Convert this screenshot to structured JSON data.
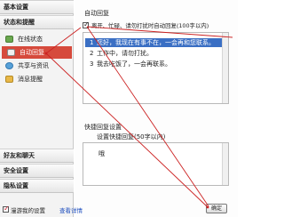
{
  "sidebar": {
    "categories": [
      {
        "label": "基本设置"
      },
      {
        "label": "状态和提醒"
      },
      {
        "label": "好友和聊天"
      },
      {
        "label": "安全设置"
      },
      {
        "label": "隐私设置"
      }
    ],
    "items": [
      {
        "label": "在线状态",
        "icon": "status-icon"
      },
      {
        "label": "自动回复",
        "icon": "auto-reply-icon"
      },
      {
        "label": "共享与资讯",
        "icon": "share-icon"
      },
      {
        "label": "消息提醒",
        "icon": "message-icon"
      }
    ]
  },
  "auto_reply": {
    "section_title": "自动回复",
    "checkbox_label": "离开、忙碌、请勿打扰时自动回复(100字以内)",
    "rows": [
      {
        "num": "1",
        "text": "您好，我现在有事不在，一会再和您联系。"
      },
      {
        "num": "2",
        "text": "工作中，请勿打扰。"
      },
      {
        "num": "3",
        "text": "我去吃饭了，一会再联系。"
      }
    ]
  },
  "quick_reply": {
    "section_title": "快捷回复设置",
    "field_label": "设置快捷回复(50字以内)",
    "value": "哦"
  },
  "footer": {
    "checkbox_label": "漫游我的设置",
    "link_label": "查看详情",
    "ok_button": "确定"
  },
  "colors": {
    "selected_red": "#d64a3c",
    "selected_blue": "#3a6fc4",
    "annotation_red": "#cc2222"
  }
}
